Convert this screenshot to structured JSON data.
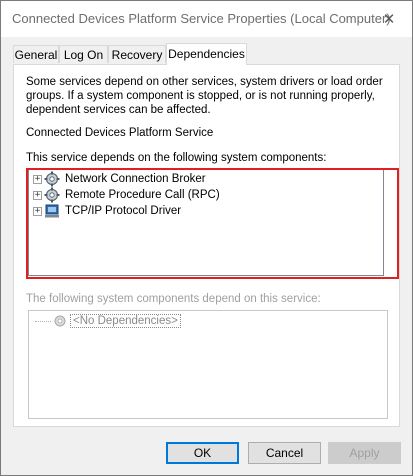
{
  "window": {
    "title": "Connected Devices Platform Service Properties (Local Computer)"
  },
  "tabs": [
    {
      "label": "General",
      "active": false
    },
    {
      "label": "Log On",
      "active": false
    },
    {
      "label": "Recovery",
      "active": false
    },
    {
      "label": "Dependencies",
      "active": true
    }
  ],
  "dependencies": {
    "description": "Some services depend on other services, system drivers or load order groups. If a system component is stopped, or is not running properly, dependent services can be affected.",
    "service_name": "Connected Devices Platform Service",
    "depends_on_label": "This service depends on the following system components:",
    "depends_on": [
      {
        "label": "Network Connection Broker",
        "icon": "gear-service-icon"
      },
      {
        "label": "Remote Procedure Call (RPC)",
        "icon": "gear-service-icon"
      },
      {
        "label": "TCP/IP Protocol Driver",
        "icon": "driver-icon"
      }
    ],
    "dependents_label": "The following system components depend on this service:",
    "dependents_empty": "<No Dependencies>"
  },
  "buttons": {
    "ok": "OK",
    "cancel": "Cancel",
    "apply": "Apply"
  },
  "colors": {
    "highlight": "#e02020",
    "primary_border": "#0078d7"
  }
}
